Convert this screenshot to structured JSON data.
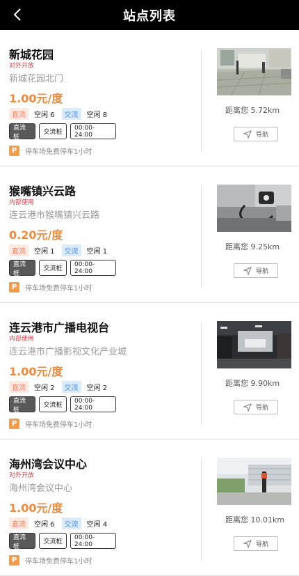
{
  "header": {
    "title": "站点列表",
    "back_icon": "chevron-left-icon"
  },
  "stations": [
    {
      "name": "新城花园",
      "status": "对外开放",
      "address": "新城花园北门",
      "price": "1.00元/度",
      "dc_label": "直流",
      "dc_free": "空闲 6",
      "ac_label": "交流",
      "ac_free": "空闲 8",
      "chip_dc": "直流桩",
      "chip_ac": "交流桩",
      "hours": "00:00-24:00",
      "parking_icon": "P",
      "parking": "停车场免费停车1小时",
      "distance": "距离您 5.72km",
      "nav_label": "导航"
    },
    {
      "name": "猴嘴镇兴云路",
      "status": "内部使用",
      "address": "连云港市猴嘴镇兴云路",
      "price": "0.20元/度",
      "dc_label": "直流",
      "dc_free": "空闲 1",
      "ac_label": "交流",
      "ac_free": "空闲 1",
      "chip_dc": "直流桩",
      "chip_ac": "交流桩",
      "hours": "00:00-24:00",
      "parking_icon": "P",
      "parking": "停车场免费停车1小时",
      "distance": "距离您 9.25km",
      "nav_label": "导航"
    },
    {
      "name": "连云港市广播电视台",
      "status": "内部使用",
      "address": "连云港市广播影视文化产业城",
      "price": "1.00元/度",
      "dc_label": "直流",
      "dc_free": "空闲 2",
      "ac_label": "交流",
      "ac_free": "空闲 2",
      "chip_dc": "直流桩",
      "chip_ac": "交流桩",
      "hours": "00:00-24:00",
      "parking_icon": "P",
      "parking": "停车场免费停车1小时",
      "distance": "距离您 9.90km",
      "nav_label": "导航"
    },
    {
      "name": "海州湾会议中心",
      "status": "对外开放",
      "address": "海州湾会议中心",
      "price": "1.00元/度",
      "dc_label": "直流",
      "dc_free": "空闲 6",
      "ac_label": "交流",
      "ac_free": "空闲 4",
      "chip_dc": "直流桩",
      "chip_ac": "交流桩",
      "hours": "00:00-24:00",
      "parking_icon": "P",
      "parking": "停车场免费停车1小时",
      "distance": "距离您 10.01km",
      "nav_label": "导航"
    }
  ],
  "colors": {
    "header_bg": "#000000",
    "price": "#f08a3a",
    "status": "#d8434b",
    "dc_tag": "#ef7c5a",
    "ac_tag": "#4a90e2",
    "parking_icon": "#f39c4a"
  }
}
